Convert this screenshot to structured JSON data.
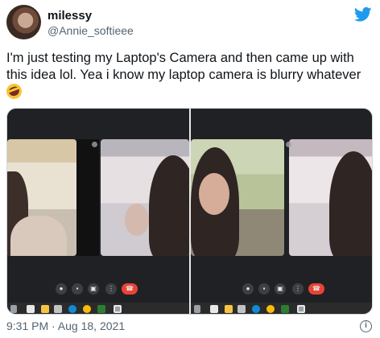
{
  "tweet": {
    "author_name": "milessy",
    "author_handle": "@Annie_softieee",
    "text_line1": "I'm just testing my Laptop's Camera and then came up with",
    "text_line2": "this idea lol. Yea i know my laptop camera is blurry whatever",
    "emoji_name": "rolling-on-floor-laughing-emoji",
    "timestamp": "9:31 PM · Aug 18, 2021",
    "info_glyph": "i"
  },
  "colors": {
    "twitter_blue": "#1d9bf0",
    "meet_end_call": "#ea4335",
    "meet_background": "#202124"
  },
  "meet_controls": [
    {
      "name": "mic-icon",
      "glyph": "●"
    },
    {
      "name": "camera-icon",
      "glyph": "▪"
    },
    {
      "name": "present-icon",
      "glyph": "▣"
    },
    {
      "name": "more-options-icon",
      "glyph": "⋮"
    },
    {
      "name": "end-call-icon",
      "glyph": "☎"
    }
  ]
}
